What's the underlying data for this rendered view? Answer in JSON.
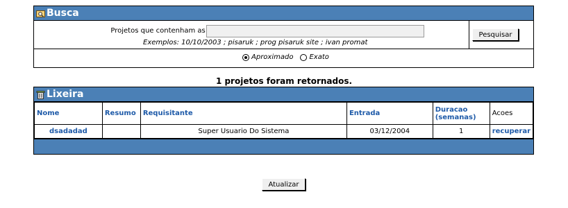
{
  "busca": {
    "title": "Busca",
    "words_label": "Projetos que contenham as palavras:",
    "words_value": "",
    "examples": "Exemplos: 10/10/2003 ; pisaruk ; prog pisaruk site ; ivan promat",
    "search_button": "Pesquisar",
    "mode_options": [
      "Aproximado",
      "Exato"
    ],
    "mode_selected": "Aproximado"
  },
  "result_message": "1 projetos foram retornados.",
  "lixeira": {
    "title": "Lixeira",
    "columns": [
      "Nome",
      "Resumo",
      "Requisitante",
      "Entrada",
      "Duracao (semanas)",
      "Acoes"
    ],
    "rows": [
      {
        "nome": "dsadadad",
        "resumo": "",
        "requisitante": "Super Usuario Do Sistema",
        "entrada": "03/12/2004",
        "duracao": "1",
        "acao": "recuperar"
      }
    ]
  },
  "refresh_button": "Atualizar",
  "colors": {
    "header_blue": "#4b80b6",
    "link_blue": "#1e5aa8"
  }
}
